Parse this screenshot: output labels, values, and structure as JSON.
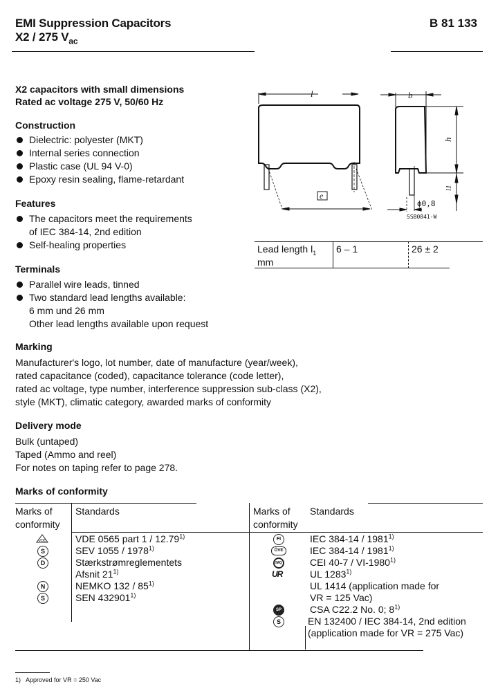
{
  "header": {
    "title": "EMI Suppression Capacitors",
    "subtitle_main": "X2 / 275 V",
    "subtitle_sub": "ac",
    "part_number": "B 81 133"
  },
  "intro": {
    "line1": "X2 capacitors with small dimensions",
    "line2": "Rated ac voltage 275 V, 50/60 Hz"
  },
  "construction": {
    "heading": "Construction",
    "items": [
      "Dielectric: polyester (MKT)",
      "Internal series connection",
      "Plastic case (UL 94 V-0)",
      "Epoxy resin sealing, flame-retardant"
    ]
  },
  "features": {
    "heading": "Features",
    "items": [
      [
        "The capacitors meet the requirements",
        "of IEC 384-14, 2nd edition"
      ],
      [
        "Self-healing properties"
      ]
    ]
  },
  "terminals": {
    "heading": "Terminals",
    "items": [
      [
        "Parallel wire leads, tinned"
      ],
      [
        "Two standard lead lengths available:",
        "6 mm und 26 mm",
        "Other lead lengths available upon request"
      ]
    ]
  },
  "drawing": {
    "label_l": "l",
    "label_b": "b",
    "label_h": "h",
    "label_l1": "l1",
    "label_e": "e",
    "label_diameter": "ϕ0,8",
    "drawing_code": "SSB0841-W"
  },
  "lead_table": {
    "label": "Lead length l",
    "label_sub": "1",
    "unit": "mm",
    "values": [
      "6 – 1",
      "26 ± 2"
    ]
  },
  "marking": {
    "heading": "Marking",
    "lines": [
      "Manufacturer's logo, lot number, date of manufacture (year/week),",
      "rated capacitance (coded), capacitance tolerance (code letter),",
      "rated ac voltage, type number, interference suppression sub-class (X2),",
      "style (MKT), climatic category, awarded marks of conformity"
    ]
  },
  "delivery": {
    "heading": "Delivery mode",
    "lines": [
      "Bulk (untaped)",
      "Taped (Ammo and reel)",
      "For notes on taping refer to page 278."
    ]
  },
  "conformity": {
    "heading": "Marks of conformity",
    "col_marks": "Marks of conformity",
    "col_marks_line1": "Marks of",
    "col_marks_line2": "conformity",
    "col_standards": "Standards",
    "left": [
      {
        "icon": "vde-mark",
        "glyph": "VDE",
        "lines": [
          "VDE 0565 part 1 / 12.79"
        ],
        "note": "1)"
      },
      {
        "icon": "sev-mark",
        "glyph": "S",
        "lines": [
          "SEV 1055 / 1978"
        ],
        "note": "1)"
      },
      {
        "icon": "demko-mark",
        "glyph": "D",
        "lines": [
          "Stærkstrømreglementets",
          "Afsnit 21"
        ],
        "note": "1)"
      },
      {
        "icon": "nemko-mark",
        "glyph": "N",
        "lines": [
          "NEMKO 132 / 85"
        ],
        "note": "1)"
      },
      {
        "icon": "semko-mark",
        "glyph": "S",
        "lines": [
          "SEN 432901"
        ],
        "note": "1)"
      }
    ],
    "right": [
      {
        "icon": "fimko-mark",
        "glyph": "FI",
        "lines": [
          "IEC 384-14 / 1981"
        ],
        "note": "1)"
      },
      {
        "icon": "ove-mark",
        "glyph": "ÖVE",
        "lines": [
          "IEC 384-14 / 1981"
        ],
        "note": "1)"
      },
      {
        "icon": "imq-mark",
        "glyph": "IMQ",
        "lines": [
          "CEI 40-7 / VI-1980"
        ],
        "note": "1)"
      },
      {
        "icon": "ul-recognized-mark",
        "glyph": "UR",
        "lines": [
          "UL 1283"
        ],
        "note": "1)"
      },
      {
        "icon": "",
        "glyph": "",
        "lines": [
          "UL 1414 (application made for",
          "VR = 125 Vac)"
        ],
        "note": ""
      },
      {
        "icon": "csa-mark",
        "glyph": "SP",
        "lines": [
          "CSA C22.2 No. 0; 8"
        ],
        "note": "1)"
      },
      {
        "icon": "semko-en-mark",
        "glyph": "S",
        "lines": [
          "EN 132400 / IEC 384-14, 2nd edition",
          "(application made for VR = 275 Vac)"
        ],
        "note": ""
      }
    ]
  },
  "footnote": {
    "marker": "1)",
    "text": "Approved for VR = 250 Vac"
  }
}
